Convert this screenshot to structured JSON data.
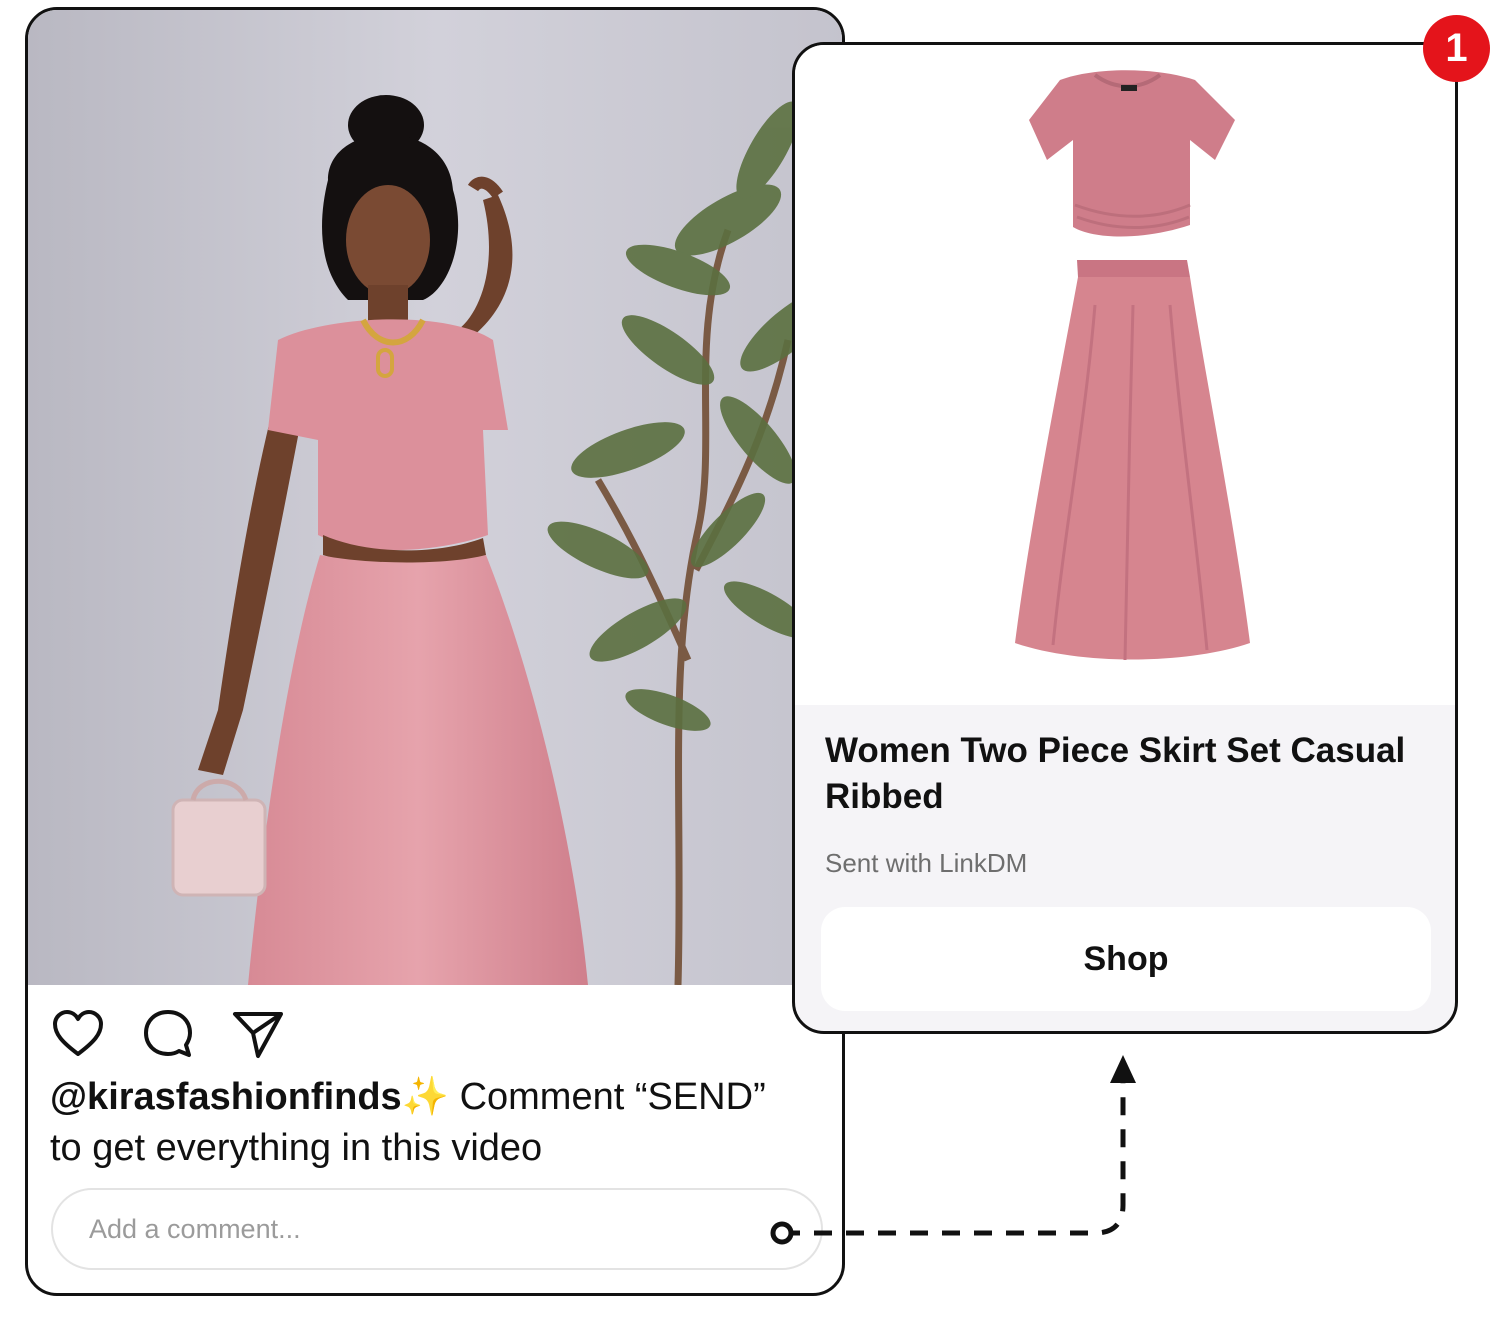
{
  "post": {
    "username": "@kirasfashionfinds",
    "sparkle": "✨",
    "caption_line1": " Comment “SEND”",
    "caption_line2": "to get everything in this video",
    "comment_placeholder": "Add a comment...",
    "actions": [
      "heart-icon",
      "comment-icon",
      "send-icon"
    ]
  },
  "product": {
    "title": "Women Two Piece Skirt Set Casual Ribbed",
    "sender": "Sent with LinkDM",
    "button_label": "Shop",
    "badge_count": "1"
  },
  "colors": {
    "accent_pink": "#d88a97",
    "badge_red": "#e4141b",
    "card_bg": "#f5f4f7"
  }
}
